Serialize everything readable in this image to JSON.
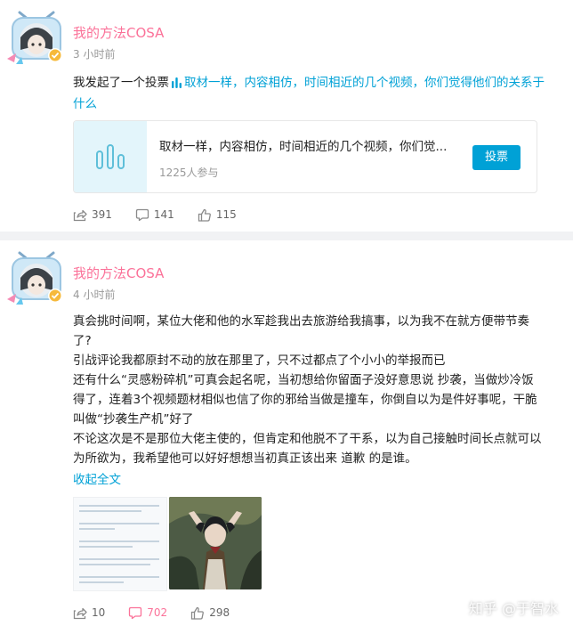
{
  "posts": [
    {
      "author": "我的方法COSA",
      "time": "3 小时前",
      "text_prefix": "我发起了一个投票",
      "text_accent": "取材一样，内容相仿，时间相近的几个视频，你们觉得他们的关系于什么",
      "vote": {
        "title": "取材一样，内容相仿，时间相近的几个视频，你们觉...",
        "count": "1225人参与",
        "button": "投票"
      },
      "actions": {
        "share": "391",
        "comment": "141",
        "like": "115"
      }
    },
    {
      "author": "我的方法COSA",
      "time": "4 小时前",
      "paragraphs": [
        "真会挑时间啊，某位大佬和他的水军趁我出去旅游给我搞事，以为我不在就方便带节奏了?",
        "引战评论我都原封不动的放在那里了，只不过都点了个小小的举报而已",
        "还有什么“灵感粉碎机”可真会起名呢，当初想给你留面子没好意思说 抄袭，当做炒冷饭得了，连着3个视频题材相似也信了你的邪给当做是撞车，你倒自以为是件好事呢，干脆叫做“抄袭生产机”好了",
        "不论这次是不是那位大佬主使的，但肯定和他脱不了干系，以为自己接触时间长点就可以为所欲为，我希望他可以好好想想当初真正该出来 道歉 的是谁。"
      ],
      "expand": "收起全文",
      "actions": {
        "share": "10",
        "comment": "702",
        "like": "298"
      }
    }
  ],
  "watermark": "知乎 @于智水",
  "colors": {
    "accent": "#00a1d6",
    "author": "#fb7299",
    "muted": "#999999"
  }
}
